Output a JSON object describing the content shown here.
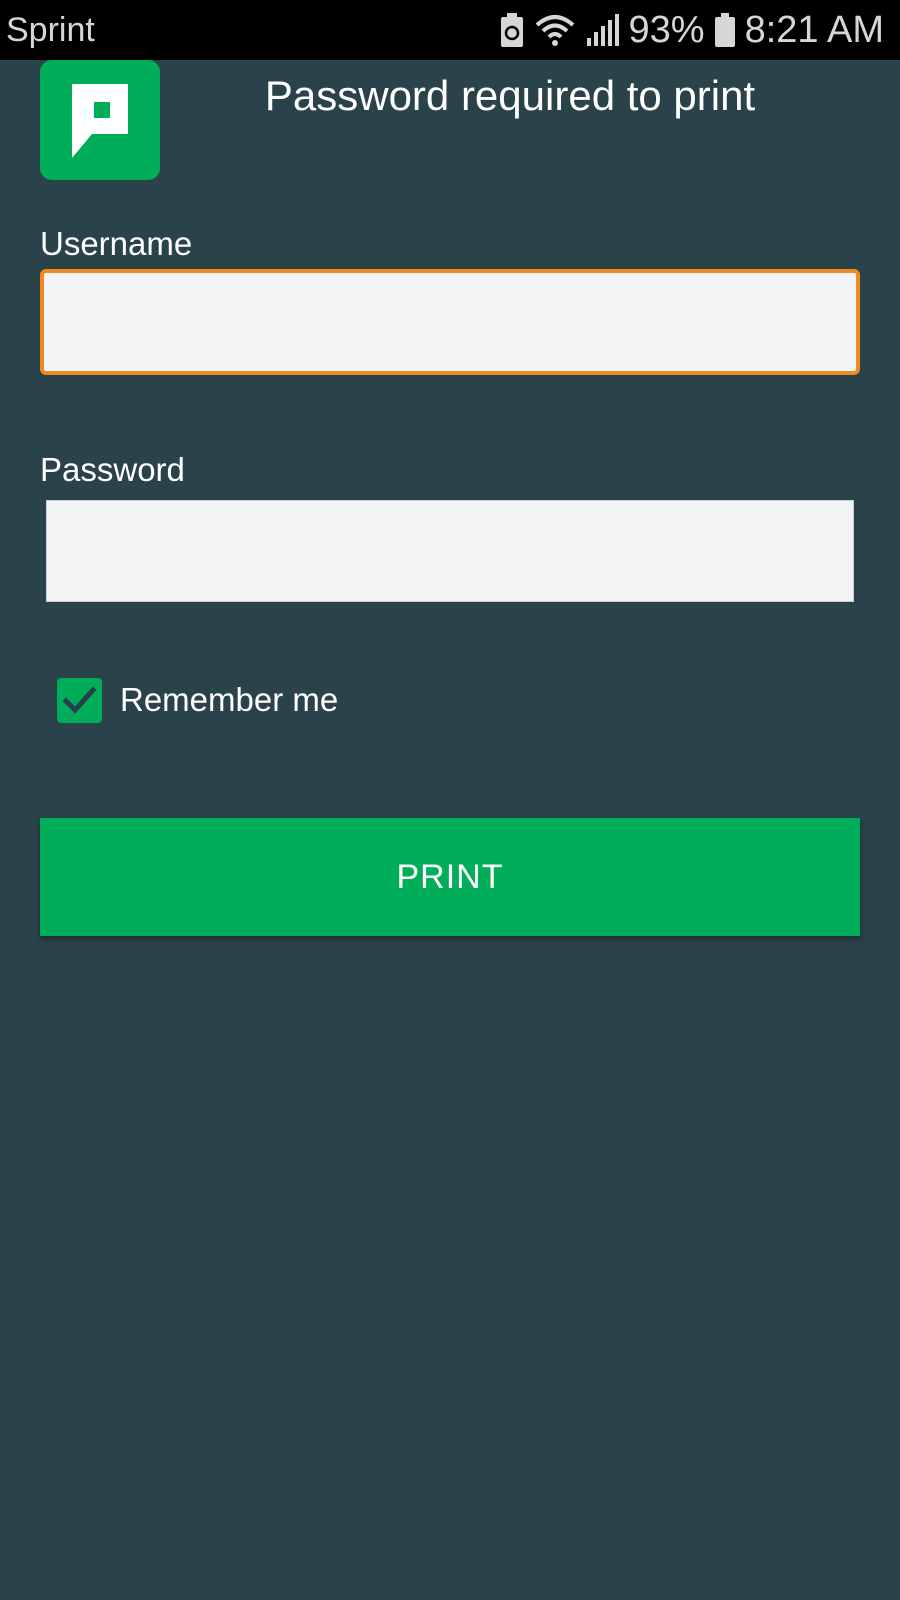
{
  "status_bar": {
    "carrier": "Sprint",
    "battery_percent": "93%",
    "time": "8:21 AM",
    "icons": [
      "battery-saver-icon",
      "wifi-icon",
      "cell-signal-icon",
      "battery-icon"
    ]
  },
  "header": {
    "logo_icon": "papercut-logo-icon",
    "title": "Password required to print"
  },
  "form": {
    "username": {
      "label": "Username",
      "value": "",
      "placeholder": "",
      "focused": true
    },
    "password": {
      "label": "Password",
      "value": "",
      "placeholder": ""
    },
    "remember_me": {
      "label": "Remember me",
      "checked": true
    },
    "submit_label": "PRINT"
  },
  "colors": {
    "background": "#2a4249",
    "accent": "#00ae5a",
    "focus_border": "#ef8a1e",
    "status_bar": "#000000"
  }
}
